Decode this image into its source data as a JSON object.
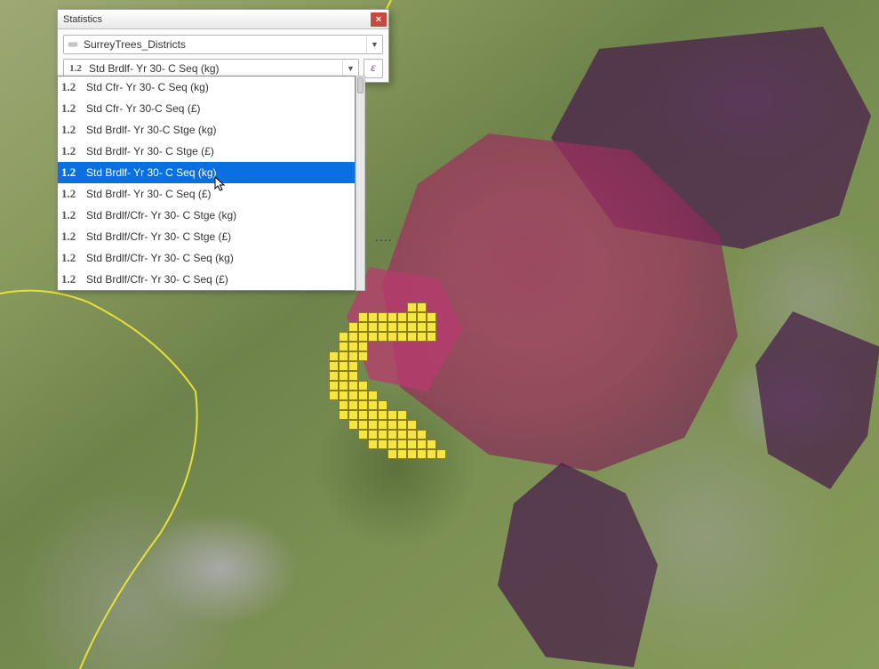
{
  "dialog": {
    "title": "Statistics",
    "close_label": "×",
    "layer_combo": {
      "text": "SurreyTrees_Districts"
    },
    "field_combo": {
      "prefix": "1.2",
      "text": "Std Brdlf- Yr 30- C Seq (kg)"
    },
    "epsilon_label": "ε",
    "more_label": "....",
    "dropdown_items": [
      {
        "prefix": "1.2",
        "label": "Std Cfr- Yr 30- C Seq (kg)",
        "selected": false
      },
      {
        "prefix": "1.2",
        "label": "Std Cfr- Yr 30-C Seq (£)",
        "selected": false
      },
      {
        "prefix": "1.2",
        "label": "Std Brdlf- Yr 30-C Stge (kg)",
        "selected": false
      },
      {
        "prefix": "1.2",
        "label": "Std Brdlf- Yr 30- C Stge (£)",
        "selected": false
      },
      {
        "prefix": "1.2",
        "label": "Std Brdlf- Yr 30- C Seq (kg)",
        "selected": true
      },
      {
        "prefix": "1.2",
        "label": "Std Brdlf- Yr 30- C Seq (£)",
        "selected": false
      },
      {
        "prefix": "1.2",
        "label": "Std Brdlf/Cfr- Yr 30- C Stge (kg)",
        "selected": false
      },
      {
        "prefix": "1.2",
        "label": "Std Brdlf/Cfr- Yr 30- C Stge (£)",
        "selected": false
      },
      {
        "prefix": "1.2",
        "label": "Std Brdlf/Cfr- Yr 30- C Seq (kg)",
        "selected": false
      },
      {
        "prefix": "1.2",
        "label": "Std Brdlf/Cfr- Yr 30- C Seq (£)",
        "selected": false
      }
    ]
  },
  "map": {
    "overlay_colors": {
      "selected_cells": "#f5e642",
      "value_low": "#4a1f4a",
      "value_high": "#b8396f",
      "boundary": "#e8e03a"
    }
  }
}
